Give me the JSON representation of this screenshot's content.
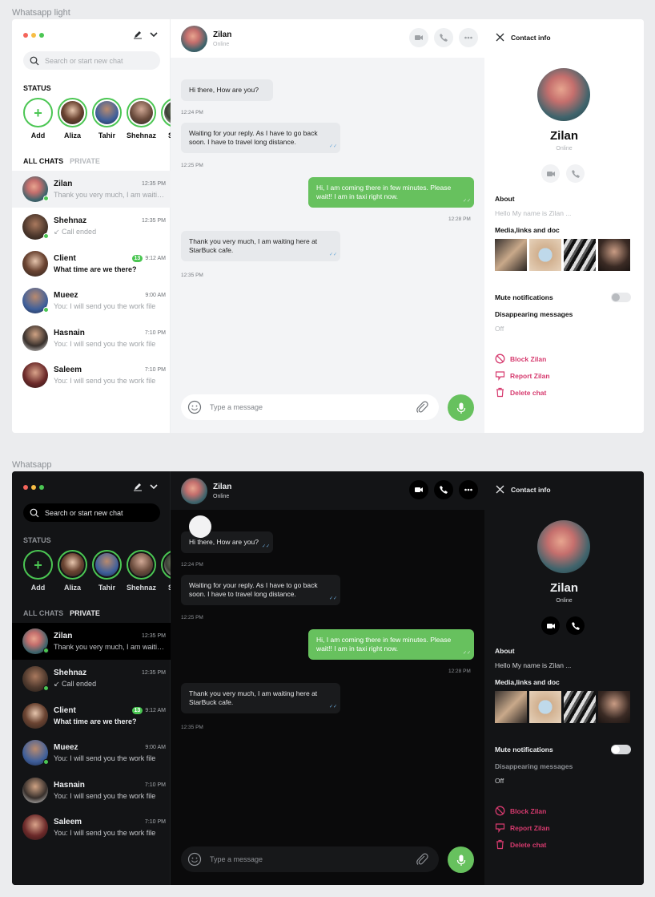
{
  "frames": {
    "light_label": "Whatsapp light",
    "dark_label": "Whatsapp"
  },
  "sidebar": {
    "search_placeholder": "Search or start new chat",
    "status_title": "STATUS",
    "statuses": [
      "Add",
      "Aliza",
      "Tahir",
      "Shehnaz",
      "Sma"
    ],
    "tab_all": "ALL CHATS",
    "tab_private": "PRIVATE",
    "chats": [
      {
        "name": "Zilan",
        "time": "12:35 PM",
        "message": "Thank you very much, I am waiting here at StarBuck cafe.",
        "online": true
      },
      {
        "name": "Shehnaz",
        "time": "12:35 PM",
        "message": "↙ Call ended",
        "online": true
      },
      {
        "name": "Client",
        "time": "9:12 AM",
        "badge": "13",
        "message": "What time are we there?",
        "online": false
      },
      {
        "name": "Mueez",
        "time": "9:00 AM",
        "message": "You: I will send you the work file",
        "online": true
      },
      {
        "name": "Hasnain",
        "time": "7:10 PM",
        "message": "You: I will send you the work file",
        "online": false
      },
      {
        "name": "Saleem",
        "time": "7:10 PM",
        "message": "You: I will send you the work file",
        "online": false
      }
    ]
  },
  "conversation": {
    "contact_name": "Zilan",
    "contact_status": "Online",
    "messages": [
      {
        "text": "Hi there, How are you?",
        "time": "12:24 PM",
        "dir": "in"
      },
      {
        "text": "Waiting for your reply. As I have to go back soon. I have to travel long distance.",
        "time": "12:25 PM",
        "dir": "in"
      },
      {
        "text": "Hi, I am coming there in few minutes. Please wait!! I am in taxi right now.",
        "time": "12:28 PM",
        "dir": "out"
      },
      {
        "text": "Thank you very much, I am waiting here at StarBuck cafe.",
        "time": "12:35 PM",
        "dir": "in"
      }
    ],
    "compose_placeholder": "Type a message"
  },
  "contact_info": {
    "title": "Contact info",
    "name": "Zilan",
    "status": "Online",
    "about_label": "About",
    "about_value": "Hello My name is Zilan ...",
    "media_label": "Media,links and doc",
    "mute_label": "Mute notifications",
    "disappearing_label": "Disappearing messages",
    "disappearing_value": "Off",
    "block_label": "Block Zilan",
    "report_label": "Report Zilan",
    "delete_label": "Delete chat"
  },
  "colors": {
    "accent_green": "#67c15e",
    "online_green": "#4bc653",
    "danger": "#d63a6e",
    "dark_bg": "#111315",
    "light_bg": "#ffffff"
  },
  "icons": [
    "search-icon",
    "compose-icon",
    "chevron-down-icon",
    "video-icon",
    "phone-icon",
    "more-icon",
    "emoji-icon",
    "attach-icon",
    "mic-icon",
    "close-icon",
    "block-icon",
    "report-icon",
    "trash-icon"
  ]
}
